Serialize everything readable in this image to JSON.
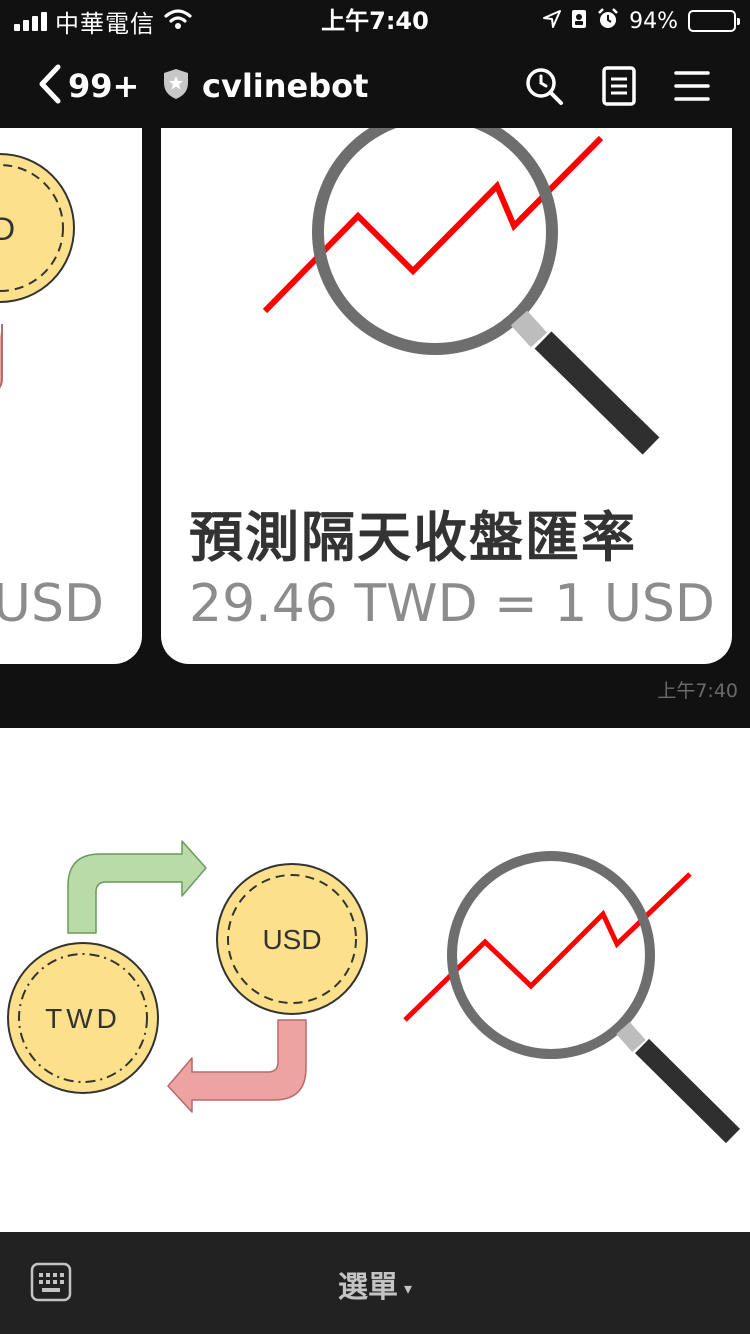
{
  "status_bar": {
    "carrier": "中華電信",
    "time": "上午7:40",
    "battery_percent": "94%",
    "battery_level": 0.94,
    "icons": [
      "signal-icon",
      "wifi-icon",
      "location-icon",
      "orientation-lock-icon",
      "alarm-icon",
      "battery-icon"
    ]
  },
  "nav": {
    "unread_count": "99+",
    "title": "cvlinebot",
    "icons": [
      "chevron-left-icon",
      "shield-star-icon",
      "search-icon",
      "notes-icon",
      "menu-icon"
    ]
  },
  "chat": {
    "cards": [
      {
        "coin_label": "D",
        "rate": "USD"
      },
      {
        "title": "預測隔天收盤匯率",
        "rate": "29.46 TWD = 1 USD"
      }
    ],
    "timestamp": "上午7:40"
  },
  "rich_menu": {
    "left": {
      "coin_twd": "TWD",
      "coin_usd": "USD"
    },
    "right": {
      "icon": "magnifier-trend-icon"
    }
  },
  "bottom_bar": {
    "menu_label": "選單",
    "caret": "▾",
    "icon": "keyboard-icon"
  },
  "colors": {
    "background_dark": "#111111",
    "bottom_bar": "#222222",
    "trend_line": "#ff0000",
    "coin_fill": "#fde08b",
    "arrow_green": "#b8dba8",
    "arrow_red": "#eea3a3"
  }
}
